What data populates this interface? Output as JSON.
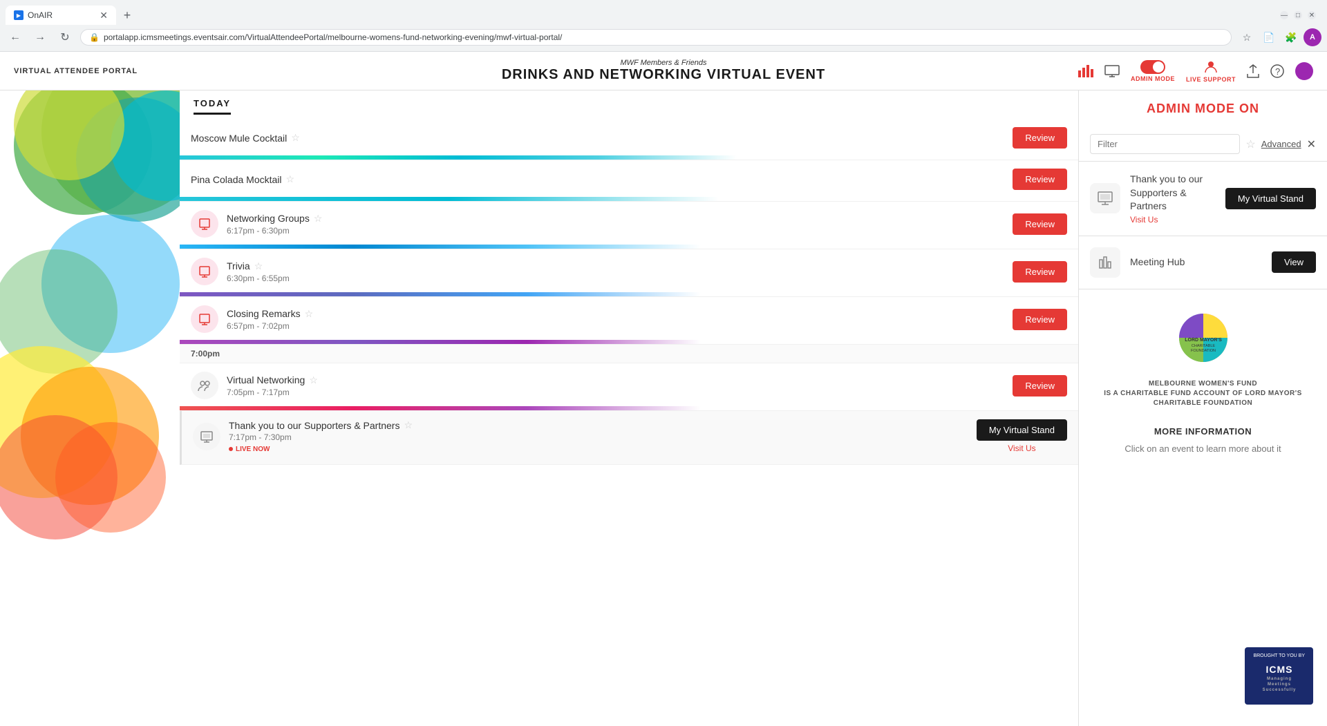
{
  "browser": {
    "tab_title": "OnAIR",
    "url": "portalapp.icmsmeetings.eventsair.com/VirtualAttendeePortal/melbourne-womens-fund-networking-evening/mwf-virtual-portal/",
    "new_tab_tooltip": "New tab"
  },
  "header": {
    "portal_label": "VIRTUAL ATTENDEE PORTAL",
    "event_subtitle": "MWF Members & Friends",
    "event_title": "DRINKS AND NETWORKING VIRTUAL EVENT",
    "admin_mode_label": "ADMIN MODE",
    "live_support_label": "LIVE SUPPORT"
  },
  "today_label": "TODAY",
  "schedule_items": [
    {
      "id": 1,
      "name": "Moscow Mule Cocktail",
      "time": "",
      "button_label": "Review",
      "button_type": "review",
      "has_icon": false,
      "is_live": false,
      "color_bar": "linear-gradient(to right, #26c6da, #1de9b6, #00bcd4, #4dd0e1)",
      "bar_width": "60%"
    },
    {
      "id": 2,
      "name": "Pina Colada Mocktail",
      "time": "",
      "button_label": "Review",
      "button_type": "review",
      "has_icon": false,
      "is_live": false,
      "color_bar": "linear-gradient(to right, #26c6da, #00bcd4)",
      "bar_width": "60%"
    },
    {
      "id": 3,
      "name": "Networking Groups",
      "time": "6:17pm - 6:30pm",
      "button_label": "Review",
      "button_type": "review",
      "has_icon": true,
      "is_live": false,
      "color_bar": "linear-gradient(to right, #29b6f6, #0288d1, #4fc3f7)",
      "bar_width": "58%"
    },
    {
      "id": 4,
      "name": "Trivia",
      "time": "6:30pm - 6:55pm",
      "button_label": "Review",
      "button_type": "review",
      "has_icon": true,
      "is_live": false,
      "color_bar": "linear-gradient(to right, #7e57c2, #5c6bc0, #42a5f5)",
      "bar_width": "58%"
    },
    {
      "id": 5,
      "name": "Closing Remarks",
      "time": "6:57pm - 7:02pm",
      "button_label": "Review",
      "button_type": "review",
      "has_icon": true,
      "is_live": false,
      "color_bar": "linear-gradient(to right, #ab47bc, #7e57c2, #9c27b0)",
      "bar_width": "58%"
    }
  ],
  "time_markers": [
    {
      "time": "7:00pm",
      "position": 5
    }
  ],
  "schedule_items_2": [
    {
      "id": 6,
      "name": "Virtual Networking",
      "time": "7:05pm - 7:17pm",
      "button_label": "Review",
      "button_type": "review",
      "has_icon": true,
      "icon_type": "people",
      "is_live": false,
      "color_bar": "linear-gradient(to right, #ef5350, #e91e63, #ab47bc)",
      "bar_width": "58%"
    },
    {
      "id": 7,
      "name": "Thank you to our Supporters & Partners",
      "time": "7:17pm - 7:30pm",
      "button_label": "My Virtual Stand",
      "button_type": "black",
      "has_icon": true,
      "icon_type": "screen",
      "is_live": true,
      "live_label": "LIVE NOW",
      "secondary_link": "Visit Us",
      "color_bar": ""
    }
  ],
  "admin_banner": {
    "text": "ADMIN MODE ON"
  },
  "filter": {
    "placeholder": "Filter",
    "advanced_label": "Advanced"
  },
  "sidebar_sessions": [
    {
      "id": 1,
      "title": "Thank you to our Supporters & Partners",
      "subtitle": "Visit Us",
      "button_label": "My Virtual Stand",
      "button_type": "black",
      "icon_type": "screen"
    },
    {
      "id": 2,
      "title": "Meeting Hub",
      "subtitle": "",
      "button_label": "View",
      "button_type": "black",
      "icon_type": "hub"
    }
  ],
  "more_info": {
    "title": "MORE INFORMATION",
    "text": "Click on an event to learn more about it"
  },
  "charity": {
    "name": "LORD MAYOR'S CHARITABLE FOUNDATION",
    "subtitle": "MELBOURNE WOMEN'S FUND",
    "description": "IS A CHARITABLE FUND ACCOUNT OF LORD MAYOR'S CHARITABLE FOUNDATION"
  },
  "icms_badge": {
    "line1": "BROUGHT TO YOU BY",
    "line2": "ICMS",
    "line3": "Managing",
    "line4": "Meetings",
    "line5": "Successfully"
  }
}
